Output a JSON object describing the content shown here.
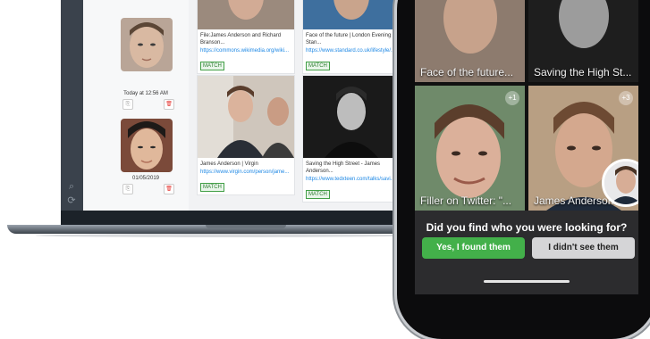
{
  "laptop": {
    "query_faces": [
      {
        "timestamp": "Today at 12:56 AM"
      },
      {
        "timestamp": "01/05/2019"
      }
    ],
    "results": [
      {
        "title": "File:James Anderson and Richard Branson...",
        "url": "https://commons.wikimedia.org/wiki...",
        "badge": "MATCH"
      },
      {
        "title": "Face of the future | London Evening Stan...",
        "url": "https://www.standard.co.uk/lifestyle/...",
        "badge": "MATCH"
      },
      {
        "title": "James Anderson | Virgin",
        "url": "https://www.virgin.com/person/jame...",
        "badge": "MATCH"
      },
      {
        "title": "Saving the High Street - James Anderson...",
        "url": "https://www.tedxteen.com/talks/savi...",
        "badge": "MATCH"
      }
    ],
    "rail_icons": [
      "search-icon",
      "settings-icon"
    ]
  },
  "phone": {
    "tiles": [
      {
        "caption": "Face of the future...",
        "count": ""
      },
      {
        "caption": "Saving the High St...",
        "count": ""
      },
      {
        "caption": "Filler on Twitter: \"...",
        "count": "+1"
      },
      {
        "caption": "James Anderson",
        "count": "+3"
      }
    ],
    "prompt": "Did you find who you were looking for?",
    "yes_label": "Yes, I found them",
    "no_label": "I didn't see them",
    "colors": {
      "yes": "#43b04a",
      "no": "#d5d5d7",
      "panel": "#2c2c2e"
    }
  }
}
